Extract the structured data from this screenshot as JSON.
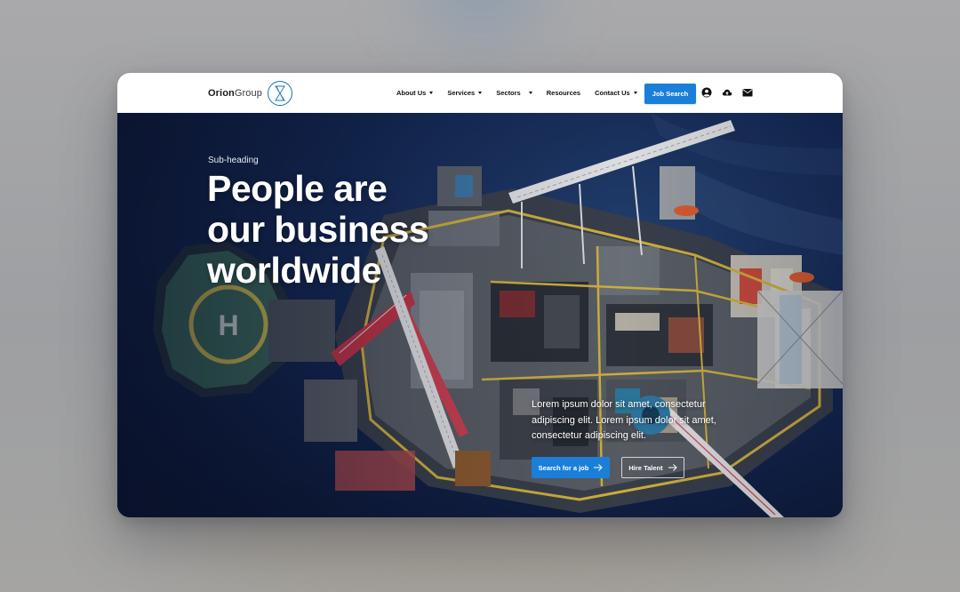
{
  "brand": {
    "bold": "Orion",
    "light": "Group"
  },
  "nav": {
    "items": [
      {
        "label": "About Us",
        "dropdown": true
      },
      {
        "label": "Services",
        "dropdown": true
      },
      {
        "label": "Sectors",
        "dropdown": true
      },
      {
        "label": "Resources",
        "dropdown": false
      },
      {
        "label": "Contact Us",
        "dropdown": true
      }
    ],
    "job_search": "Job Search",
    "icons": [
      "user-icon",
      "cloud-upload-icon",
      "mail-icon"
    ]
  },
  "hero": {
    "subheading": "Sub-heading",
    "headline_lines": [
      "People are",
      "our business",
      "worldwide"
    ],
    "copy": "Lorem ipsum dolor sit amet, consectetur adipiscing elit. Lorem ipsum dolor sit amet, consectetur adipiscing elit.",
    "primary_cta": "Search for a job",
    "secondary_cta": "Hire Talent"
  },
  "colors": {
    "accent": "#1a7fd8",
    "nav_bg": "#ffffff",
    "sea": "#0d1a36"
  }
}
